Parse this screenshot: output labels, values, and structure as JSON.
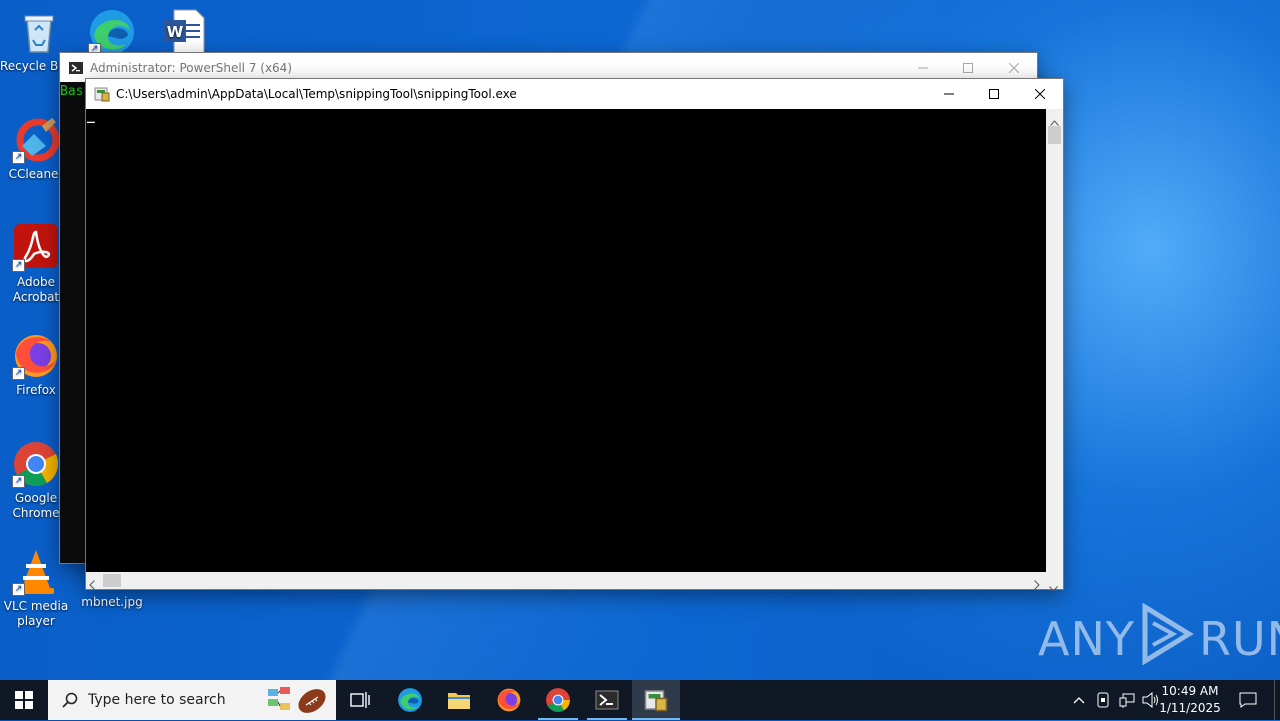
{
  "desktop": {
    "icons": [
      {
        "label": "Recycle Bin"
      },
      {
        "label": "CCleaner"
      },
      {
        "label": "Adobe Acrobat"
      },
      {
        "label": "Firefox"
      },
      {
        "label": "Google Chrome"
      },
      {
        "label": "VLC media player"
      },
      {
        "label": "mbnet.jpg"
      }
    ]
  },
  "powershell_window": {
    "title": "Administrator: PowerShell 7 (x64)",
    "visible_text": "Bas"
  },
  "snipping_window": {
    "title": "C:\\Users\\admin\\AppData\\Local\\Temp\\snippingTool\\snippingTool.exe",
    "cursor": "_"
  },
  "taskbar": {
    "search_placeholder": "Type here to search",
    "time": "10:49 AM",
    "date": "1/11/2025"
  },
  "watermark": {
    "left": "ANY",
    "right": "RUN"
  },
  "colors": {
    "taskbar_bg": "#101826",
    "console_bg": "#000000",
    "console_text": "#16c60c"
  }
}
